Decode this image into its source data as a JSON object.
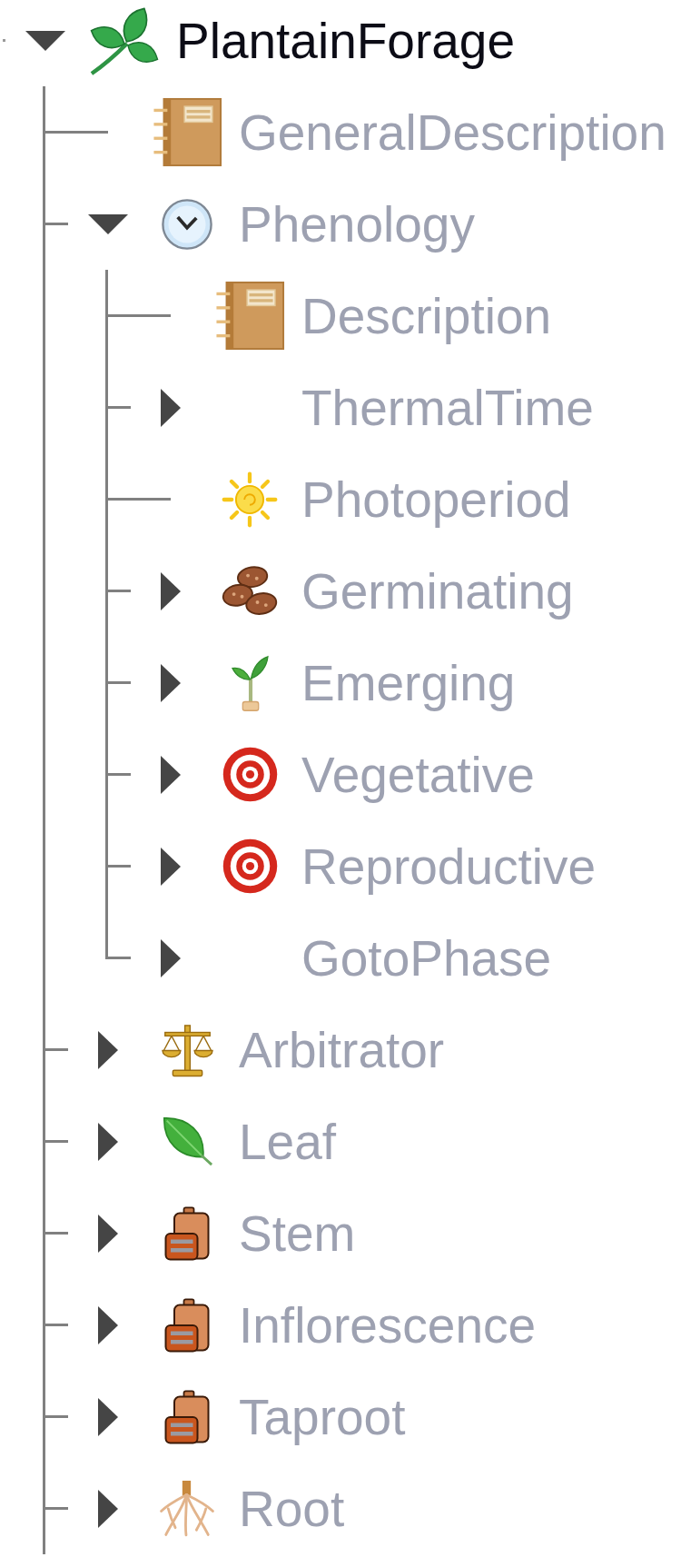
{
  "tree": {
    "label": "PlantainForage",
    "kind": "leaves",
    "expanded": true,
    "disabled": false,
    "more_below": true,
    "children": [
      {
        "label": "GeneralDescription",
        "kind": "notebook",
        "disabled": true
      },
      {
        "label": "Phenology",
        "kind": "clock",
        "expanded": true,
        "disabled": true,
        "children": [
          {
            "label": "Description",
            "kind": "notebook",
            "disabled": true
          },
          {
            "label": "ThermalTime",
            "expanded": false,
            "disabled": true
          },
          {
            "label": "Photoperiod",
            "kind": "sun",
            "disabled": true
          },
          {
            "label": "Germinating",
            "kind": "seeds",
            "expanded": false,
            "disabled": true
          },
          {
            "label": "Emerging",
            "kind": "seedling",
            "expanded": false,
            "disabled": true
          },
          {
            "label": "Vegetative",
            "kind": "target",
            "expanded": false,
            "disabled": true
          },
          {
            "label": "Reproductive",
            "kind": "target",
            "expanded": false,
            "disabled": true
          },
          {
            "label": "GotoPhase",
            "expanded": false,
            "disabled": true
          }
        ]
      },
      {
        "label": "Arbitrator",
        "kind": "scales",
        "expanded": false,
        "disabled": true
      },
      {
        "label": "Leaf",
        "kind": "leaf",
        "expanded": false,
        "disabled": true
      },
      {
        "label": "Stem",
        "kind": "bag",
        "expanded": false,
        "disabled": true
      },
      {
        "label": "Inflorescence",
        "kind": "bag",
        "expanded": false,
        "disabled": true
      },
      {
        "label": "Taproot",
        "kind": "bag",
        "expanded": false,
        "disabled": true
      },
      {
        "label": "Root",
        "kind": "roots",
        "expanded": false,
        "disabled": true
      }
    ]
  }
}
